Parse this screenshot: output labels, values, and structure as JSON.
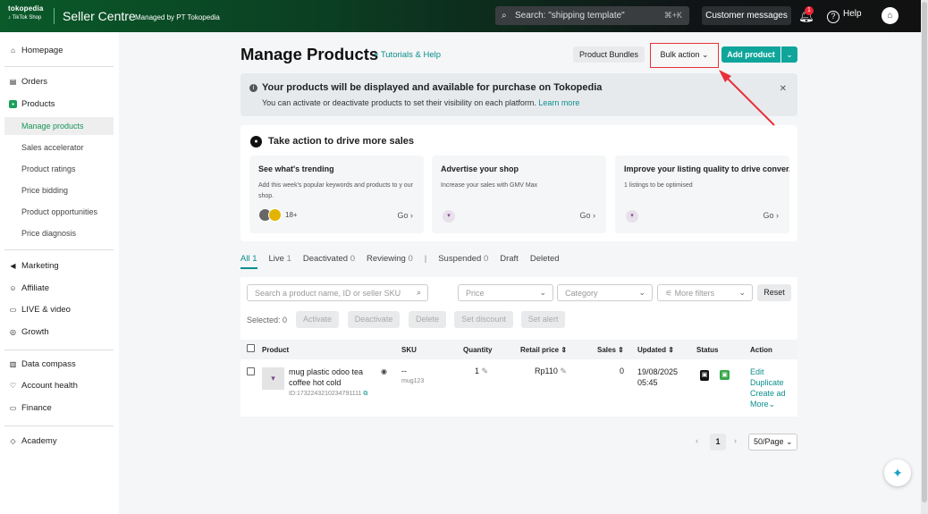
{
  "topbar": {
    "logo_line1": "tokopedia",
    "logo_line2": "TikTok Shop",
    "brand": "Seller Centre",
    "managed": "Managed by PT Tokopedia",
    "search_placeholder": "Search: \"shipping template\"",
    "search_shortcut": "⌘+K",
    "customer_messages": "Customer messages",
    "notification_count": "1",
    "help": "Help"
  },
  "sidebar": {
    "homepage": "Homepage",
    "orders": "Orders",
    "products": "Products",
    "sub": [
      "Manage products",
      "Sales accelerator",
      "Product ratings",
      "Price bidding",
      "Product opportunities",
      "Price diagnosis"
    ],
    "marketing": "Marketing",
    "affiliate": "Affiliate",
    "live": "LIVE & video",
    "growth": "Growth",
    "data_compass": "Data compass",
    "account_health": "Account health",
    "finance": "Finance",
    "academy": "Academy"
  },
  "header": {
    "title": "Manage Products",
    "tutorials": "Tutorials & Help",
    "product_bundles": "Product Bundles",
    "bulk_action": "Bulk action",
    "add_product": "Add product"
  },
  "banner": {
    "title": "Your products will be displayed and available for purchase on Tokopedia",
    "desc": "You can activate or deactivate products to set their visibility on each platform.",
    "learn_more": "Learn more"
  },
  "actions": {
    "title": "Take action to drive more sales",
    "cards": [
      {
        "title": "See what's trending",
        "desc": "Add this week's popular keywords and products to y our shop.",
        "extra": "18+",
        "go": "Go"
      },
      {
        "title": "Advertise your shop",
        "desc": "Increase your sales with GMV Max",
        "go": "Go"
      },
      {
        "title": "Improve your listing quality to drive conver...",
        "desc": "1 listings to be optimised",
        "go": "Go"
      }
    ]
  },
  "tabs": [
    {
      "label": "All",
      "count": "1"
    },
    {
      "label": "Live",
      "count": "1"
    },
    {
      "label": "Deactivated",
      "count": "0"
    },
    {
      "label": "Reviewing",
      "count": "0"
    },
    {
      "label": "Suspended",
      "count": "0"
    },
    {
      "label": "Draft",
      "count": ""
    },
    {
      "label": "Deleted",
      "count": ""
    }
  ],
  "filters": {
    "search_placeholder": "Search a product name, ID or seller SKU",
    "price": "Price",
    "category": "Category",
    "more_filters": "More filters",
    "reset": "Reset",
    "selected_label": "Selected:",
    "selected_count": "0",
    "activate": "Activate",
    "deactivate": "Deactivate",
    "delete": "Delete",
    "set_discount": "Set discount",
    "set_alert": "Set alert"
  },
  "table": {
    "headers": {
      "product": "Product",
      "sku": "SKU",
      "quantity": "Quantity",
      "retail_price": "Retail price",
      "sales": "Sales",
      "updated": "Updated",
      "status": "Status",
      "action": "Action"
    },
    "row": {
      "name": "mug plastic odoo tea coffee hot cold",
      "id": "ID:1732243210234791111",
      "sku": "--",
      "seller_sku": "mug123",
      "quantity": "1",
      "price": "Rp110",
      "sales": "0",
      "date": "19/08/2025",
      "time": "05:45",
      "actions": [
        "Edit",
        "Duplicate",
        "Create ad",
        "More"
      ]
    }
  },
  "pagination": {
    "page": "1",
    "page_size": "50/Page"
  },
  "colors": {
    "accent": "#0c8e8e",
    "primary_button": "#10a59b",
    "highlight": "#e8303a"
  }
}
